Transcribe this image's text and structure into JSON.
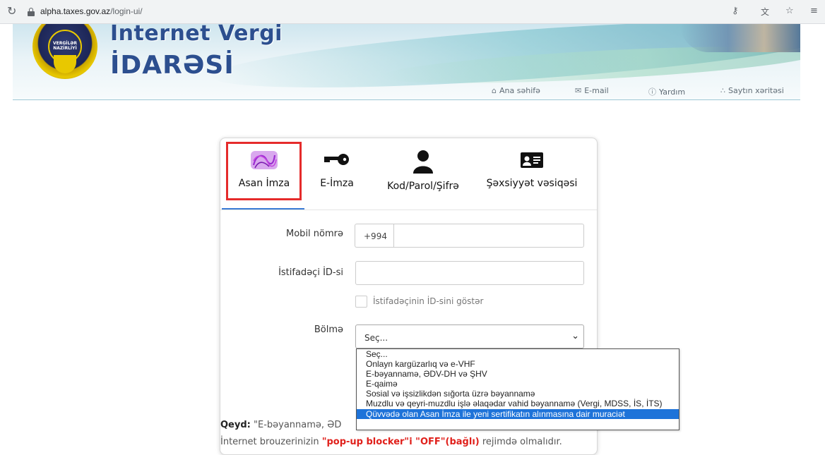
{
  "browser": {
    "reload_icon": "reload-icon",
    "url_host": "alpha.taxes.gov.az",
    "url_path": "/login-ui/",
    "toolbar_icons": [
      "key-icon",
      "translate-icon",
      "star-icon",
      "menu-icon"
    ]
  },
  "header": {
    "logo_line1": "Internet Vergi",
    "logo_line2": "İDARƏSİ",
    "emblem_text_1": "VERGİLƏR",
    "emblem_text_2": "NAZİRLİYİ",
    "nav": [
      {
        "label": "Ana səhifə",
        "icon": "home-icon"
      },
      {
        "label": "E-mail",
        "icon": "mail-icon"
      },
      {
        "label": "Yardım",
        "icon": "help-icon"
      },
      {
        "label": "Saytın xəritəsi",
        "icon": "sitemap-icon"
      }
    ]
  },
  "login": {
    "tabs": [
      {
        "label": "Asan İmza",
        "icon": "asan-imza-icon",
        "active": true
      },
      {
        "label": "E-İmza",
        "icon": "key-icon",
        "active": false
      },
      {
        "label": "Kod/Parol/Şifrə",
        "icon": "user-icon",
        "active": false
      },
      {
        "label": "Şəxsiyyət vəsiqəsi",
        "icon": "id-card-icon",
        "active": false
      }
    ],
    "phone_label": "Mobil nömrə",
    "phone_prefix": "+994",
    "phone_value": "",
    "userid_label": "İstifadəçi İD-si",
    "userid_value": "",
    "show_id_label": "İstifadəçinin İD-sini göstər",
    "section_label": "Bölmə",
    "section_selected": "Seç...",
    "section_options": [
      "Seç...",
      "Onlayn kargüzarlıq və e-VHF",
      "E-bəyannamə, ƏDV-DH və ŞHV",
      "E-qaimə",
      "Sosial və işsizlikdən sığorta üzrə bəyannamə",
      "Muzdlu və qeyri-muzdlu işlə əlaqədar vahid bəyannamə (Vergi, MDSS, İS, İTS)",
      "Qüvvədə olan Asan İmza ile yeni sertifikatın alınmasına dair muraciət"
    ],
    "highlighted_option_index": 6,
    "note_title": "Qeyd:",
    "note_text_1": "\"E-bəyannamə, ƏD",
    "note_text_2a": "İnternet brouzerinizin ",
    "note_text_2b": "\"pop-up blocker\"i \"OFF\"(bağlı)",
    "note_text_2c": " rejimdə olmalıdır."
  },
  "colors": {
    "accent_blue": "#3a7bd5",
    "highlight_red": "#e52b2b",
    "selected_option": "#1e73d9",
    "logo_blue": "#2c4f8f"
  }
}
